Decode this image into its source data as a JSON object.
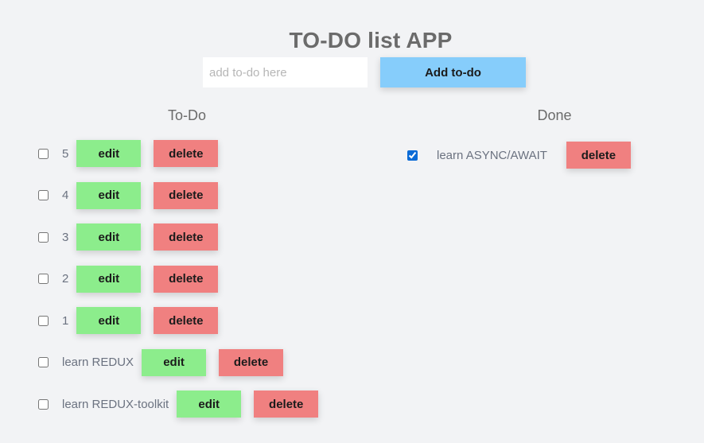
{
  "header": {
    "title": "TO-DO list APP"
  },
  "add_form": {
    "placeholder": "add to-do here",
    "value": "",
    "button_label": "Add to-do"
  },
  "columns": {
    "todo_heading": "To-Do",
    "done_heading": "Done"
  },
  "todo_items": [
    {
      "text": "5",
      "checked": false,
      "edit_label": "edit",
      "delete_label": "delete"
    },
    {
      "text": "4",
      "checked": false,
      "edit_label": "edit",
      "delete_label": "delete"
    },
    {
      "text": "3",
      "checked": false,
      "edit_label": "edit",
      "delete_label": "delete"
    },
    {
      "text": "2",
      "checked": false,
      "edit_label": "edit",
      "delete_label": "delete"
    },
    {
      "text": "1",
      "checked": false,
      "edit_label": "edit",
      "delete_label": "delete"
    },
    {
      "text": "learn REDUX",
      "checked": false,
      "edit_label": "edit",
      "delete_label": "delete"
    },
    {
      "text": "learn REDUX-toolkit",
      "checked": false,
      "edit_label": "edit",
      "delete_label": "delete"
    }
  ],
  "done_items": [
    {
      "text": "learn ASYNC/AWAIT",
      "checked": true,
      "delete_label": "delete"
    }
  ],
  "colors": {
    "background": "#f2f3f5",
    "add_button": "#86cdfb",
    "edit_button": "#8ced8c",
    "delete_button": "#f08080",
    "title_text": "#6b6b6b"
  }
}
